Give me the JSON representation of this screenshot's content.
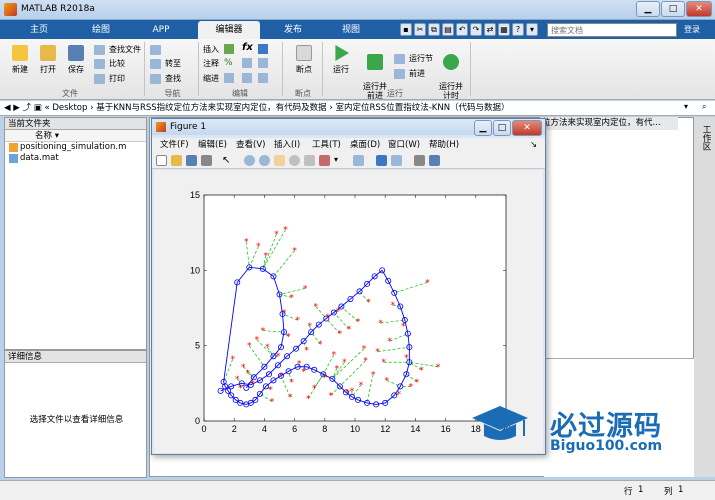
{
  "app": {
    "title": "MATLAB R2018a",
    "min_icon": "minimize-icon",
    "max_icon": "maximize-icon",
    "close_icon": "close-icon"
  },
  "tabs": [
    "主页",
    "绘图",
    "APP",
    "编辑器",
    "发布",
    "视图"
  ],
  "active_tab": "编辑器",
  "search": {
    "placeholder": "搜索文档",
    "submit": "登录"
  },
  "ribbon": {
    "file": {
      "new": "新建",
      "open": "打开",
      "save": "保存",
      "find_files": "查找文件",
      "compare": "比较",
      "print": "打印",
      "group": "文件"
    },
    "navigate": {
      "goto": "转至",
      "find": "查找",
      "group": "导航"
    },
    "edit": {
      "insert": "插入",
      "comment": "注释",
      "indent": "缩进",
      "fx": "fx",
      "group": "编辑"
    },
    "breakpoints": {
      "label": "断点",
      "group": "断点"
    },
    "run": {
      "run": "运行",
      "run_advance": "运行并\n前进",
      "run_section": "运行节",
      "advance": "前进",
      "run_time": "运行并\n计时",
      "group": "运行"
    }
  },
  "address": {
    "path": "« Desktop › 基于KNN与RSS指纹定位方法来实现室内定位，有代码及数据 › 室内定位RSS位置指纹法-KNN（代码与数据）"
  },
  "current_folder": {
    "title": "当前文件夹",
    "column": "名称 ▾",
    "files": [
      {
        "name": "positioning_simulation.m",
        "type": "m"
      },
      {
        "name": "data.mat",
        "type": "mat"
      }
    ]
  },
  "detail": {
    "title": "详细信息",
    "message": "选择文件以查看详细信息"
  },
  "editor_tab": "位方法来实现室内定位，有代...",
  "workspace_label": "工作区",
  "figure": {
    "title": "Figure 1",
    "menu": [
      "文件(F)",
      "编辑(E)",
      "查看(V)",
      "插入(I)",
      "工具(T)",
      "桌面(D)",
      "窗口(W)",
      "帮助(H)"
    ]
  },
  "status": {
    "row_label": "行",
    "row": "1",
    "col_label": "列",
    "col": "1"
  },
  "watermark": {
    "main": "必过源码",
    "sub": "Biguo100.com"
  },
  "chart_data": {
    "type": "scatter",
    "xlim": [
      0,
      20
    ],
    "ylim": [
      0,
      15
    ],
    "xticks": [
      0,
      2,
      4,
      6,
      8,
      10,
      12,
      14,
      16,
      18,
      20
    ],
    "yticks": [
      0,
      5,
      10,
      15
    ],
    "grid": false,
    "series": [
      {
        "style": "blue-circle-line",
        "color": "#0000ff",
        "x": [
          1.1,
          1.8,
          2.5,
          3.1,
          3.7,
          4.3,
          4.9,
          5.5,
          6.1,
          6.6,
          7.1,
          7.6,
          8.1,
          8.6,
          9.1,
          9.7,
          10.3,
          10.8,
          11.3,
          11.8,
          12.2,
          12.6,
          13.0,
          13.3,
          13.5,
          13.6,
          13.6,
          13.4,
          13.0,
          12.6,
          12.0,
          11.4,
          10.8,
          10.2,
          9.8,
          9.4,
          9.0,
          8.5,
          7.9,
          7.3,
          6.8,
          6.2,
          5.6,
          5.1,
          4.6,
          4.1,
          3.7,
          3.4,
          3.1,
          2.8,
          2.4,
          2.1,
          1.8,
          1.6,
          1.4,
          1.3,
          2.2,
          3.0,
          3.9,
          4.6,
          5.0,
          5.2,
          5.3,
          5.1,
          4.6,
          4.0,
          3.3,
          2.8
        ],
        "y": [
          2.0,
          2.3,
          2.5,
          2.4,
          2.7,
          3.1,
          3.7,
          4.3,
          4.8,
          5.3,
          5.9,
          6.4,
          6.8,
          7.2,
          7.6,
          8.1,
          8.6,
          9.1,
          9.6,
          10.0,
          9.3,
          8.5,
          7.6,
          6.7,
          5.8,
          4.9,
          3.9,
          3.1,
          2.3,
          1.7,
          1.2,
          1.1,
          1.2,
          1.4,
          1.6,
          1.9,
          2.3,
          2.8,
          3.1,
          3.4,
          3.6,
          3.6,
          3.3,
          3.0,
          2.7,
          2.3,
          1.8,
          1.4,
          1.2,
          1.1,
          1.2,
          1.4,
          1.7,
          2.0,
          2.3,
          2.6,
          9.2,
          10.2,
          10.1,
          9.6,
          8.4,
          7.1,
          5.9,
          4.9,
          4.3,
          3.6,
          2.9,
          2.2
        ]
      },
      {
        "style": "red-star",
        "color": "#ff0000",
        "x": [
          4.8,
          5.4,
          3.6,
          2.8,
          4.1,
          6.0,
          5.8,
          6.7,
          7.4,
          8.2,
          8.9,
          9.6,
          10.2,
          10.9,
          11.7,
          12.5,
          13.2,
          14.8,
          15.5,
          9.3,
          8.6,
          7.7,
          6.8,
          6.3,
          5.6,
          4.9,
          4.2,
          3.5,
          2.9,
          2.2,
          1.9,
          2.6,
          3.2,
          4.4,
          5.1,
          5.8,
          6.6,
          7.3,
          8.0,
          8.8,
          9.5,
          10.4,
          11.2,
          12.1,
          12.9,
          13.7,
          14.4,
          11.5,
          12.3,
          10.7,
          9.0,
          7.0,
          6.2,
          5.3,
          3.9,
          3.0,
          2.4,
          4.5,
          5.7,
          6.9,
          8.4,
          9.8,
          10.6,
          11.9,
          13.4,
          14.1
        ],
        "y": [
          12.4,
          12.7,
          11.6,
          11.9,
          11.0,
          11.3,
          8.2,
          8.8,
          7.6,
          6.9,
          7.3,
          6.1,
          6.6,
          7.9,
          6.5,
          7.7,
          6.3,
          9.2,
          3.6,
          3.9,
          4.4,
          5.1,
          4.7,
          3.8,
          5.6,
          4.3,
          4.9,
          5.4,
          3.2,
          2.8,
          4.1,
          3.6,
          2.5,
          2.1,
          3.0,
          2.6,
          3.3,
          2.2,
          2.9,
          3.5,
          1.9,
          2.4,
          3.1,
          2.7,
          1.8,
          2.3,
          3.4,
          4.6,
          5.3,
          4.0,
          5.8,
          6.3,
          6.7,
          7.2,
          6.0,
          5.0,
          2.2,
          1.3,
          1.6,
          1.5,
          1.7,
          2.0,
          4.8,
          3.9,
          4.2,
          2.6
        ]
      }
    ],
    "links_description": "green dashed lines connect each estimated position to its true position"
  }
}
